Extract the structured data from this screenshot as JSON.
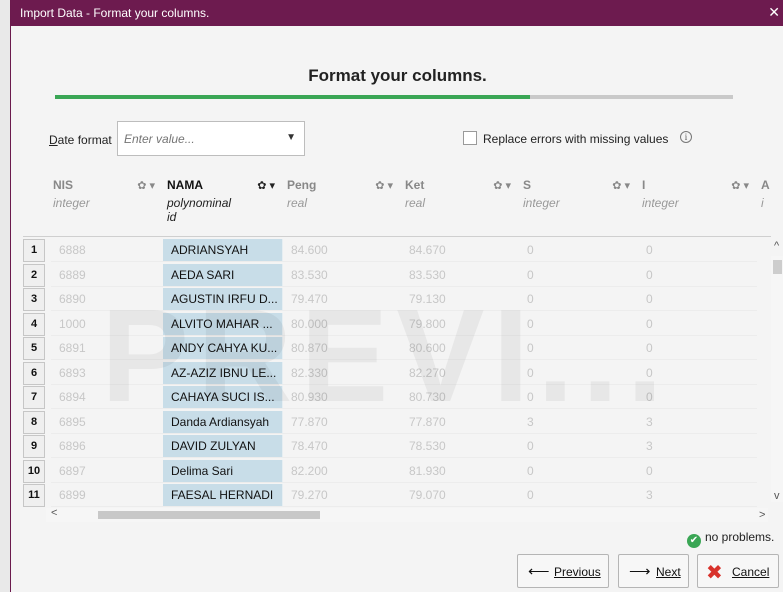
{
  "window": {
    "title": "Import Data - Format your columns.",
    "close_glyph": "✕"
  },
  "heading": "Format your columns.",
  "progress": {
    "fraction": 0.7,
    "color": "#3aa655"
  },
  "date_format": {
    "label_prefix": "D",
    "label_rest": "ate format",
    "placeholder": "Enter value...",
    "caret": "▼"
  },
  "replace_errors": {
    "label": "Replace errors with missing values",
    "checked": false,
    "info_glyph": "i"
  },
  "columns": [
    {
      "name": "NIS",
      "type": "integer",
      "role": "",
      "active": false
    },
    {
      "name": "NAMA",
      "type": "polynominal",
      "role": "id",
      "active": true
    },
    {
      "name": "Peng",
      "type": "real",
      "role": "",
      "active": false
    },
    {
      "name": "Ket",
      "type": "real",
      "role": "",
      "active": false
    },
    {
      "name": "S",
      "type": "integer",
      "role": "",
      "active": false
    },
    {
      "name": "I",
      "type": "integer",
      "role": "",
      "active": false
    },
    {
      "name": "A",
      "type": "i",
      "role": "",
      "active": false
    }
  ],
  "gear_glyph": "✿ ▾",
  "rows": [
    {
      "n": "1",
      "cells": [
        "6888",
        "ADRIANSYAH",
        "84.600",
        "84.670",
        "0",
        "0"
      ]
    },
    {
      "n": "2",
      "cells": [
        "6889",
        "AEDA SARI",
        "83.530",
        "83.530",
        "0",
        "0"
      ]
    },
    {
      "n": "3",
      "cells": [
        "6890",
        "AGUSTIN IRFU D...",
        "79.470",
        "79.130",
        "0",
        "0"
      ]
    },
    {
      "n": "4",
      "cells": [
        "1000",
        "ALVITO MAHAR ...",
        "80.000",
        "79.800",
        "0",
        "0"
      ]
    },
    {
      "n": "5",
      "cells": [
        "6891",
        "ANDY CAHYA KU...",
        "80.870",
        "80.600",
        "0",
        "0"
      ]
    },
    {
      "n": "6",
      "cells": [
        "6893",
        "AZ-AZIZ IBNU LE...",
        "82.330",
        "82.270",
        "0",
        "0"
      ]
    },
    {
      "n": "7",
      "cells": [
        "6894",
        "CAHAYA SUCI IS...",
        "80.930",
        "80.730",
        "0",
        "0"
      ]
    },
    {
      "n": "8",
      "cells": [
        "6895",
        "Danda Ardiansyah",
        "77.870",
        "77.870",
        "3",
        "3"
      ]
    },
    {
      "n": "9",
      "cells": [
        "6896",
        "DAVID ZULYAN",
        "78.470",
        "78.530",
        "0",
        "3"
      ]
    },
    {
      "n": "10",
      "cells": [
        "6897",
        "Delima Sari",
        "82.200",
        "81.930",
        "0",
        "0"
      ]
    },
    {
      "n": "11",
      "cells": [
        "6899",
        "FAESAL HERNADI",
        "79.270",
        "79.070",
        "0",
        "3"
      ]
    }
  ],
  "watermark": "PREVI...",
  "status": {
    "text": "no problems.",
    "ok_glyph": "✔"
  },
  "buttons": {
    "previous": {
      "label": "Previous",
      "icon": "⟵"
    },
    "next": {
      "label": "Next",
      "icon": "⟶"
    },
    "cancel": {
      "label": "Cancel",
      "icon": "✖"
    }
  },
  "colors": {
    "title_bar": "#6d1b4f",
    "accent": "#3aa655",
    "active_column": "#c8dde8",
    "cancel_icon": "#d8322b"
  }
}
